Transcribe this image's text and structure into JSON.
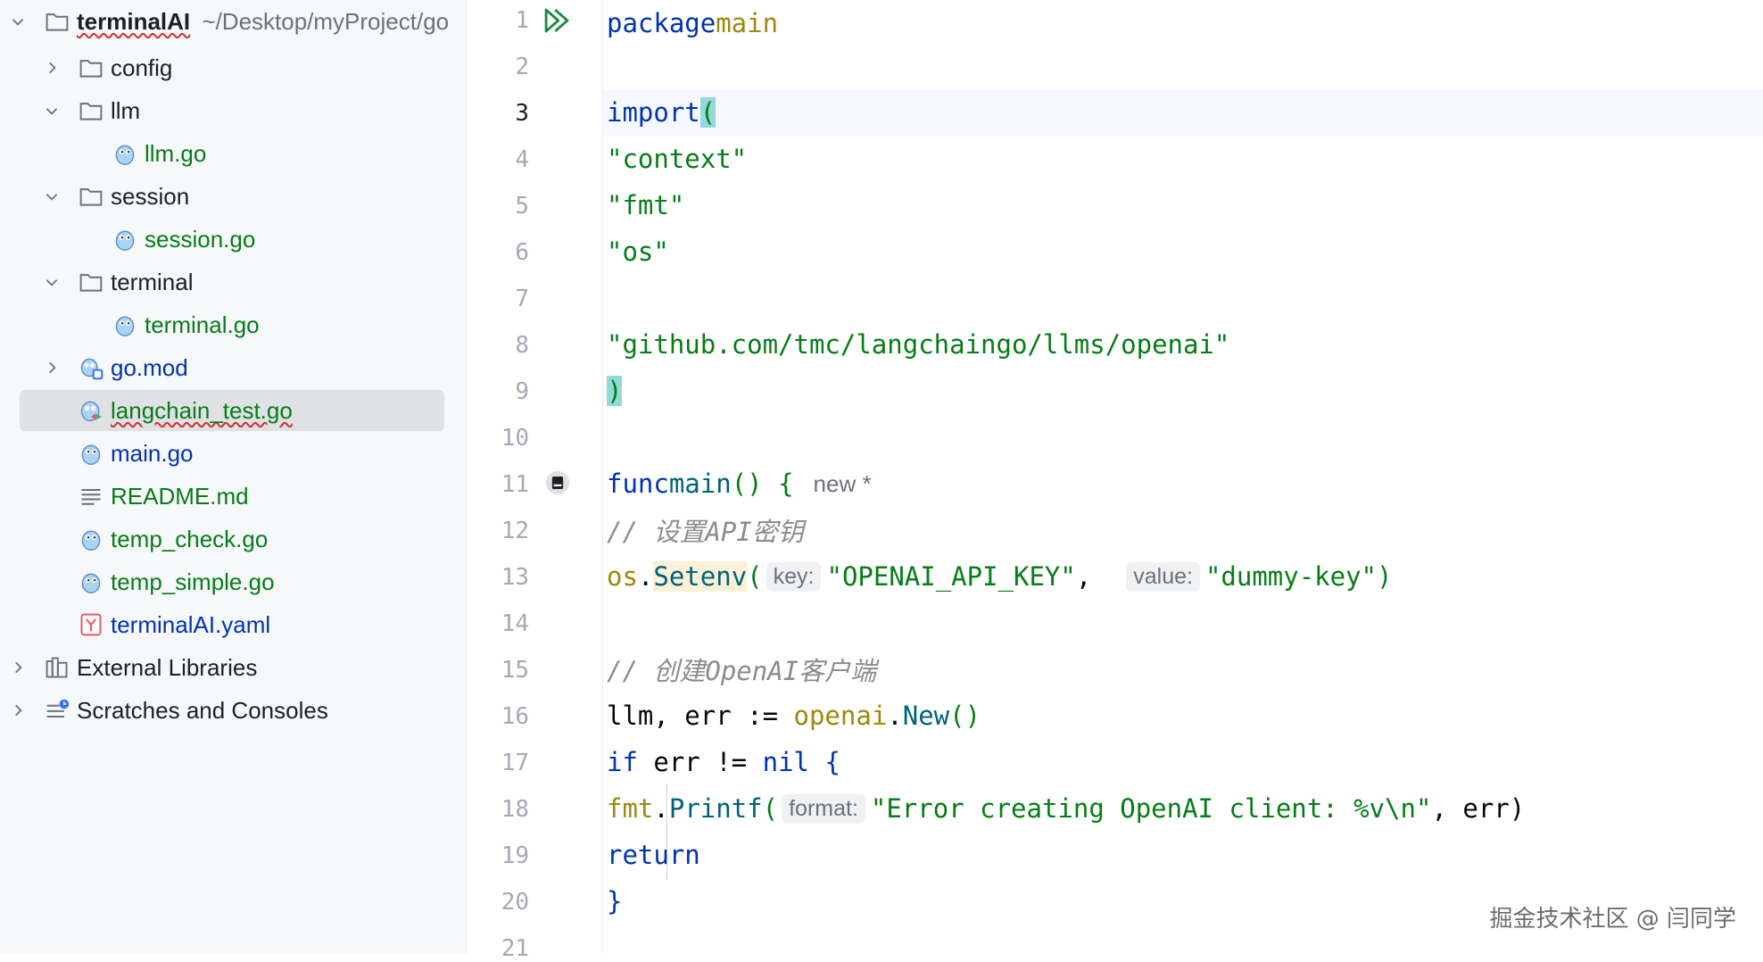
{
  "project_tree": {
    "root": {
      "name": "terminalAI",
      "path": "~/Desktop/myProject/go"
    },
    "items": [
      {
        "label": "config",
        "type": "folder",
        "expanded": false
      },
      {
        "label": "llm",
        "type": "folder",
        "expanded": true
      },
      {
        "label": "llm.go",
        "type": "go-file"
      },
      {
        "label": "session",
        "type": "folder",
        "expanded": true
      },
      {
        "label": "session.go",
        "type": "go-file"
      },
      {
        "label": "terminal",
        "type": "folder",
        "expanded": true
      },
      {
        "label": "terminal.go",
        "type": "go-file"
      },
      {
        "label": "go.mod",
        "type": "go-mod",
        "expanded": false
      },
      {
        "label": "langchain_test.go",
        "type": "go-test-file",
        "selected": true
      },
      {
        "label": "main.go",
        "type": "go-file"
      },
      {
        "label": "README.md",
        "type": "markdown-file"
      },
      {
        "label": "temp_check.go",
        "type": "go-file"
      },
      {
        "label": "temp_simple.go",
        "type": "go-file"
      },
      {
        "label": "terminalAI.yaml",
        "type": "yaml-file"
      },
      {
        "label": "External Libraries",
        "type": "libraries",
        "expanded": false
      },
      {
        "label": "Scratches and Consoles",
        "type": "scratches",
        "expanded": false
      }
    ]
  },
  "editor": {
    "line_numbers": [
      "1",
      "2",
      "3",
      "4",
      "5",
      "6",
      "7",
      "8",
      "9",
      "10",
      "11",
      "12",
      "13",
      "14",
      "15",
      "16",
      "17",
      "18",
      "19",
      "20",
      "21"
    ],
    "current_line": "3",
    "code": {
      "l1_kw": "package",
      "l1_name": "main",
      "l3_kw": "import",
      "l3_paren": "(",
      "l4": "\"context\"",
      "l5": "\"fmt\"",
      "l6": "\"os\"",
      "l8": "\"github.com/tmc/langchaingo/llms/openai\"",
      "l9": ")",
      "l11_kw": "func",
      "l11_fn": "main",
      "l11_rest": "() {",
      "l11_hint": "new *",
      "l12": "// 设置API密钥",
      "l13_pkg": "os",
      "l13_fn": "Setenv",
      "l13_hint1": "key:",
      "l13_arg1": "\"OPENAI_API_KEY\"",
      "l13_hint2": "value:",
      "l13_arg2": "\"dummy-key\"",
      "l15": "// 创建OpenAI客户端",
      "l16_vars": "llm, err := ",
      "l16_pkg": "openai",
      "l16_fn": "New",
      "l16_rest": "()",
      "l17_kw": "if",
      "l17_mid": " err != ",
      "l17_nil": "nil",
      "l17_rest": " {",
      "l18_pkg": "fmt",
      "l18_fn": "Printf",
      "l18_hint": "format:",
      "l18_str": "\"Error creating OpenAI client: %v\\n\"",
      "l18_rest": ", err)",
      "l19": "return",
      "l20": "}"
    }
  },
  "watermark": "掘金技术社区 @ 闫同学",
  "colors": {
    "keyword": "#0033b3",
    "string": "#067d17",
    "comment": "#8c8c8c",
    "function": "#00627a",
    "selection": "#dfe1e5",
    "brace_match": "#93d9d9"
  }
}
